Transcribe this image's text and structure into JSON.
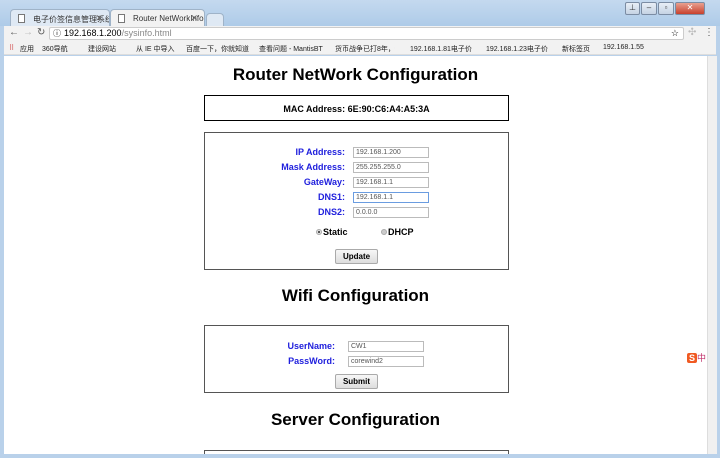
{
  "browser": {
    "tabs": [
      {
        "title": "电子价签信息管理系统"
      },
      {
        "title": "Router NetWorkInfo"
      }
    ],
    "url_host": "192.168.1.200",
    "url_path": "/sysinfo.html",
    "bookmarks": [
      "应用",
      "360导航",
      "建设网站",
      "从 IE 中导入",
      "百度一下，你就知道",
      "查看问题 - MantisBT",
      "货币战争已打8年，€",
      "192.168.1.81电子价",
      "192.168.1.23电子价",
      "新标签页",
      "192.168.1.55"
    ]
  },
  "page": {
    "title": "Router NetWork Configuration",
    "mac": "MAC Address: 6E:90:C6:A4:A5:3A",
    "network": {
      "fields": [
        {
          "label": "IP Address:",
          "value": "192.168.1.200"
        },
        {
          "label": "Mask Address:",
          "value": "255.255.255.0"
        },
        {
          "label": "GateWay:",
          "value": "192.168.1.1"
        },
        {
          "label": "DNS1:",
          "value": "192.168.1.1"
        },
        {
          "label": "DNS2:",
          "value": "0.0.0.0"
        }
      ],
      "static_label": "Static",
      "dhcp_label": "DHCP",
      "selected": "Static",
      "update_label": "Update"
    },
    "wifi_title": "Wifi Configuration",
    "wifi": {
      "fields": [
        {
          "label": "UserName:",
          "value": "CW1"
        },
        {
          "label": "PassWord:",
          "value": "corewind2"
        }
      ],
      "submit_label": "Submit"
    },
    "server_title": "Server Configuration"
  },
  "ime": {
    "label": "中"
  },
  "colors": {
    "label_blue": "#2020dd"
  }
}
